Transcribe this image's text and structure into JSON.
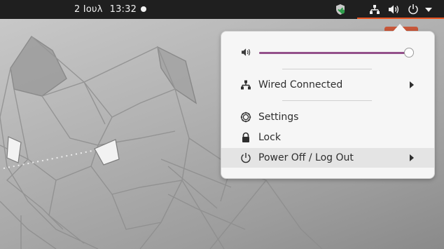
{
  "topbar": {
    "date": "2 Ιουλ",
    "time": "13:32",
    "accent_color": "#e95420",
    "icons": [
      "notification-dot",
      "shield-icon",
      "network-wired-icon",
      "volume-icon",
      "power-icon",
      "dropdown-arrow-icon"
    ]
  },
  "system_menu": {
    "volume": {
      "level": 0.98,
      "icon": "volume-icon",
      "fill_color": "#93508a"
    },
    "items": [
      {
        "label": "Wired Connected",
        "icon": "network-wired-icon",
        "has_submenu": true
      },
      {
        "label": "Settings",
        "icon": "gear-icon",
        "has_submenu": false
      },
      {
        "label": "Lock",
        "icon": "lock-icon",
        "has_submenu": false
      },
      {
        "label": "Power Off / Log Out",
        "icon": "power-icon",
        "has_submenu": true,
        "highlighted": true
      }
    ]
  }
}
